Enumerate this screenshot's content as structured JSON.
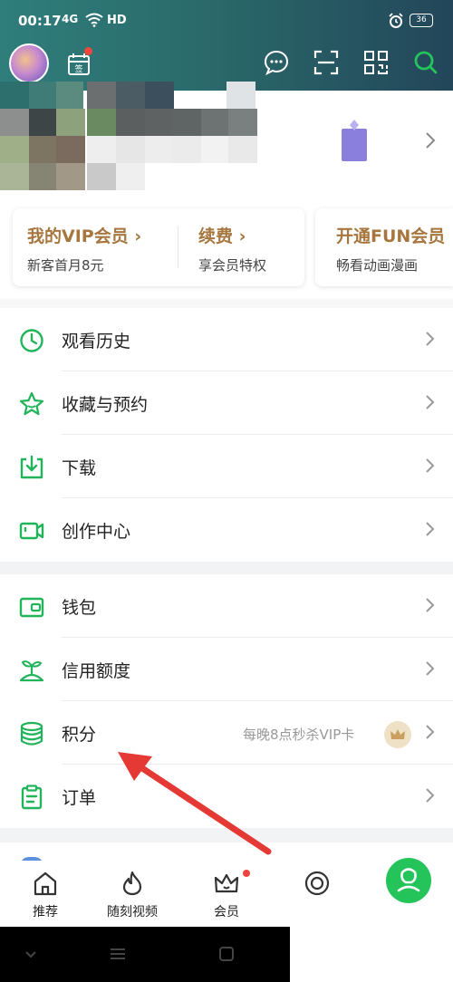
{
  "status_bar": {
    "time": "00:17",
    "network": "4G",
    "hd": "HD",
    "battery": "36"
  },
  "header": {
    "sign_badge_text": "签",
    "icons": [
      "message-icon",
      "scan-icon",
      "qr-code-icon",
      "search-icon"
    ]
  },
  "vip_cards": [
    {
      "title": "我的VIP会员 ›",
      "subtitle": "新客首月8元"
    },
    {
      "title": "续费 ›",
      "subtitle": "享会员特权"
    },
    {
      "title": "开通FUN会员",
      "subtitle": "畅看动画漫画"
    }
  ],
  "menu_group_1": [
    {
      "label": "观看历史",
      "icon": "clock-icon"
    },
    {
      "label": "收藏与预约",
      "icon": "star-icon"
    },
    {
      "label": "下载",
      "icon": "download-icon"
    },
    {
      "label": "创作中心",
      "icon": "video-camera-icon"
    }
  ],
  "menu_group_2": [
    {
      "label": "钱包",
      "icon": "wallet-icon"
    },
    {
      "label": "信用额度",
      "icon": "sprout-icon"
    },
    {
      "label": "积分",
      "icon": "coins-icon",
      "extra": "每晚8点秒杀VIP卡"
    },
    {
      "label": "订单",
      "icon": "clipboard-icon"
    }
  ],
  "tabbar": [
    {
      "label": "推荐",
      "icon": "home-icon"
    },
    {
      "label": "随刻视频",
      "icon": "flame-icon"
    },
    {
      "label": "会员",
      "icon": "crown-icon"
    },
    {
      "label": "",
      "icon": "circle-tab-icon"
    }
  ],
  "colors": {
    "accent_green": "#24c45b",
    "vip_gold": "#a6763e",
    "arrow_red": "#e53935"
  }
}
